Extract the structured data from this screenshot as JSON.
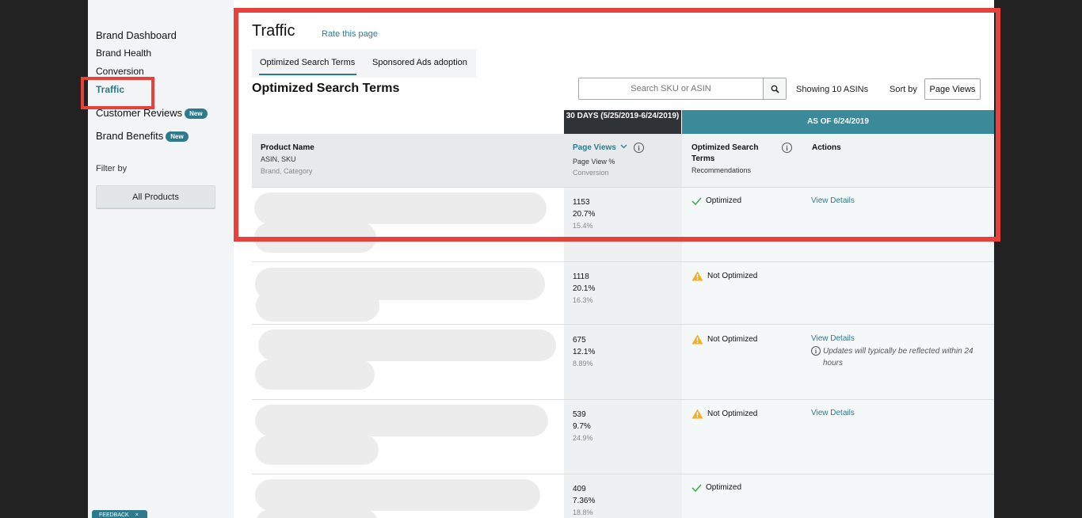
{
  "sidebar": {
    "items": [
      {
        "label": "Brand Dashboard"
      },
      {
        "label": "Brand Health"
      },
      {
        "label": "Conversion"
      },
      {
        "label": "Traffic"
      },
      {
        "label": "Customer Reviews",
        "badge": "New"
      },
      {
        "label": "Brand Benefits",
        "badge": "New"
      }
    ],
    "filter_label": "Filter by",
    "all_products": "All Products",
    "feedback": "FEEDBACK",
    "feedback_close": "×"
  },
  "header": {
    "title": "Traffic",
    "rate_link": "Rate this page"
  },
  "tabs": [
    {
      "label": "Optimized Search Terms",
      "active": true
    },
    {
      "label": "Sponsored Ads adoption",
      "active": false
    }
  ],
  "section": {
    "title": "Optimized Search Terms",
    "search_placeholder": "Search SKU or ASIN",
    "showing": "Showing 10 ASINs",
    "sort_label": "Sort by",
    "sort_value": "Page Views"
  },
  "table": {
    "group_headers": {
      "thirty_days": "30 DAYS (5/25/2019-6/24/2019)",
      "as_of": "AS OF 6/24/2019"
    },
    "columns": {
      "product": {
        "title": "Product Name",
        "sub1": "ASIN, SKU",
        "sub2": "Brand, Category"
      },
      "page_views": {
        "title": "Page Views",
        "sub1": "Page View %",
        "sub2": "Conversion"
      },
      "ost": {
        "title": "Optimized Search Terms",
        "sub1": "Recommendations"
      },
      "actions": {
        "title": "Actions"
      }
    },
    "rows": [
      {
        "page_views": "1153",
        "page_view_pct": "20.7%",
        "conversion": "15.4%",
        "status": "Optimized",
        "action": "View Details",
        "note": ""
      },
      {
        "page_views": "1118",
        "page_view_pct": "20.1%",
        "conversion": "16.3%",
        "status": "Not Optimized",
        "action": "",
        "note": ""
      },
      {
        "page_views": "675",
        "page_view_pct": "12.1%",
        "conversion": "8.89%",
        "status": "Not Optimized",
        "action": "View Details",
        "note": "Updates will typically be reflected within 24 hours"
      },
      {
        "page_views": "539",
        "page_view_pct": "9.7%",
        "conversion": "24.9%",
        "status": "Not Optimized",
        "action": "View Details",
        "note": ""
      },
      {
        "page_views": "409",
        "page_view_pct": "7.36%",
        "conversion": "18.8%",
        "status": "Optimized",
        "action": "",
        "note": ""
      }
    ]
  },
  "colors": {
    "accent": "#2d7a8c",
    "highlight": "#e8403a",
    "header_dark": "#2f3237",
    "header_teal": "#3a8a9a",
    "ok": "#3aa94e",
    "warn": "#f2b01e"
  }
}
